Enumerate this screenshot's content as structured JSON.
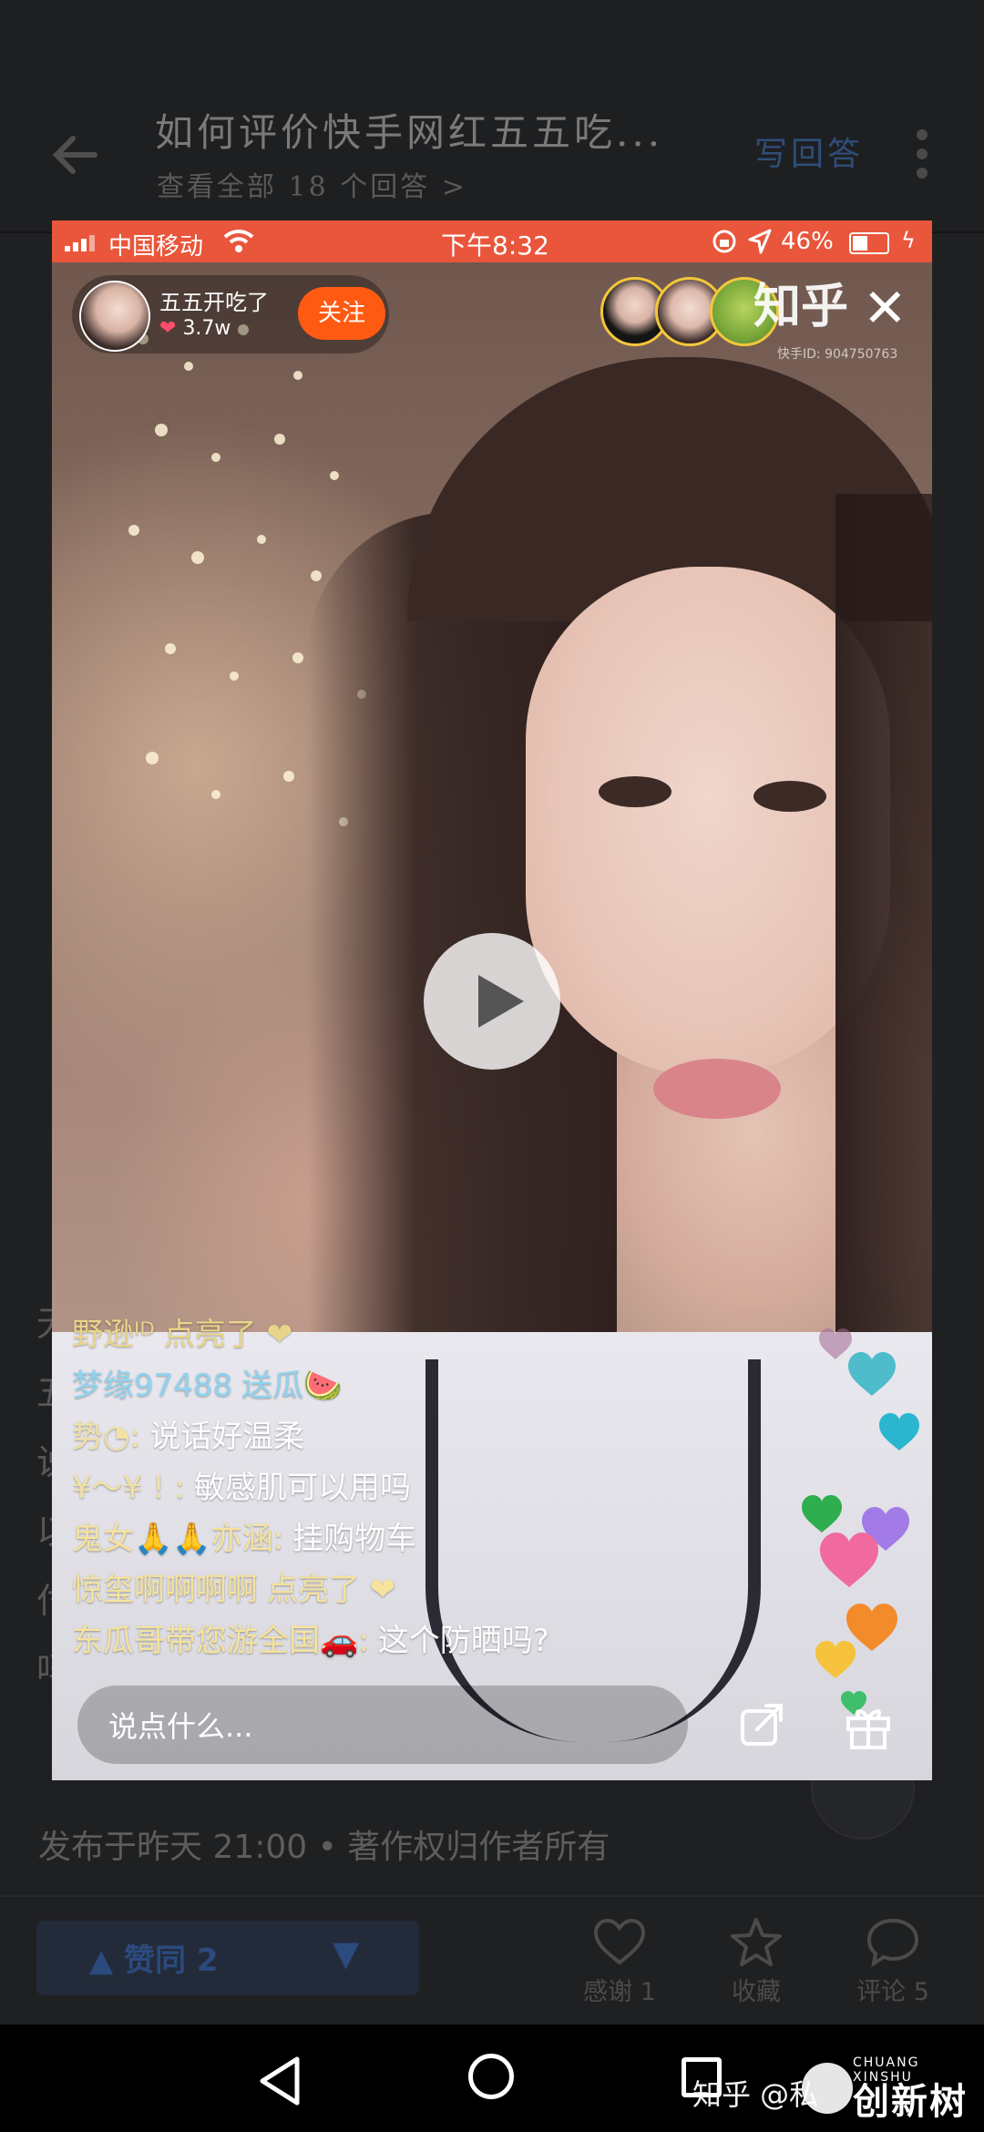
{
  "app": {
    "question_title": "如何评价快手网红五五吃...",
    "view_all": "查看全部 18 个回答 >",
    "write_answer": "写回答",
    "bg_text": [
      "无",
      "五",
      "说",
      "以",
      "付",
      "吗"
    ],
    "publish_info": "发布于昨天 21:00 • 著作权归作者所有",
    "vote_up": "赞同 2",
    "actions": [
      {
        "icon": "heart-icon",
        "label": "感谢 1"
      },
      {
        "icon": "star-icon",
        "label": "收藏"
      },
      {
        "icon": "comment-icon",
        "label": "评论 5"
      }
    ]
  },
  "video": {
    "status": {
      "carrier": "中国移动",
      "time": "下午8:32",
      "battery": "46%"
    },
    "host": {
      "name": "五五开吃了",
      "likes": "3.7w",
      "follow": "关注"
    },
    "brand_tag": "知乎",
    "kuaishou_id": "快手ID: 904750763",
    "comments": [
      {
        "user": "野逊ᴵᴰ",
        "text": "点亮了 ❤",
        "color": "#e9d58a"
      },
      {
        "user": "梦缘97488",
        "text": "送瓜🍉",
        "color": "#8fd3f0"
      },
      {
        "user": "势◔:",
        "text": "说话好温柔",
        "color": "#f1e2a4"
      },
      {
        "user": "¥～¥  !  :",
        "text": "敏感肌可以用吗",
        "color": "#f1e2a4"
      },
      {
        "user": "鬼女🙏🙏亦涵:",
        "text": "挂购物车",
        "color": "#f6e39c"
      },
      {
        "user": "惊玺啊啊啊啊",
        "text": "点亮了 ❤",
        "color": "#f6e39c"
      },
      {
        "user": "东瓜哥带您游全国🚗:",
        "text": "这个防晒吗?",
        "color": "#f6e39c"
      }
    ],
    "input_placeholder": "说点什么..."
  },
  "system": {
    "watermark": "知乎 @私",
    "logo_text": "创新树",
    "logo_en": "CHUANG XINSHU"
  },
  "colors": {
    "status_bar": "#e9563b",
    "follow_button": "#ff5a12",
    "vote_blue": "#2b4a7d"
  }
}
